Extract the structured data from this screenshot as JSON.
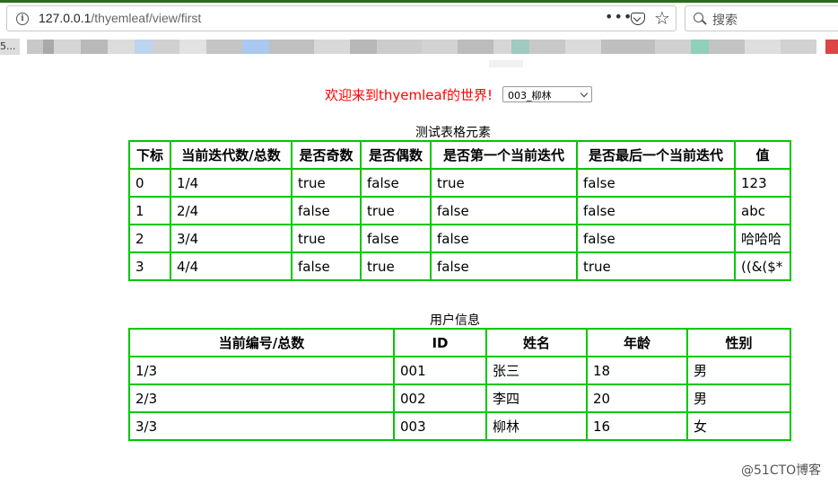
{
  "browser": {
    "url_host": "127.0.0.1",
    "url_path": "/thyemleaf/view/first",
    "search_placeholder": "搜索",
    "more_label": "•••",
    "star_label": "☆",
    "bookmark_mark": "5..."
  },
  "welcome": {
    "text": "欢迎来到thyemleaf的世界!",
    "selected": "003_柳林"
  },
  "table1": {
    "caption": "测试表格元素",
    "headers": [
      "下标",
      "当前迭代数/总数",
      "是否奇数",
      "是否偶数",
      "是否第一个当前迭代",
      "是否最后一个当前迭代",
      "值"
    ],
    "rows": [
      [
        "0",
        "1/4",
        "true",
        "false",
        "true",
        "false",
        "123"
      ],
      [
        "1",
        "2/4",
        "false",
        "true",
        "false",
        "false",
        "abc"
      ],
      [
        "2",
        "3/4",
        "true",
        "false",
        "false",
        "false",
        "哈哈哈"
      ],
      [
        "3",
        "4/4",
        "false",
        "true",
        "false",
        "true",
        "((&($*"
      ]
    ]
  },
  "table2": {
    "caption": "用户信息",
    "headers": [
      "当前编号/总数",
      "ID",
      "姓名",
      "年龄",
      "性别"
    ],
    "rows": [
      [
        "1/3",
        "001",
        "张三",
        "18",
        "男"
      ],
      [
        "2/3",
        "002",
        "李四",
        "20",
        "男"
      ],
      [
        "3/3",
        "003",
        "柳林",
        "16",
        "女"
      ]
    ]
  },
  "watermark": "@51CTO博客",
  "colors": {
    "table_border": "#00c700",
    "welcome_text": "#ff0000"
  }
}
